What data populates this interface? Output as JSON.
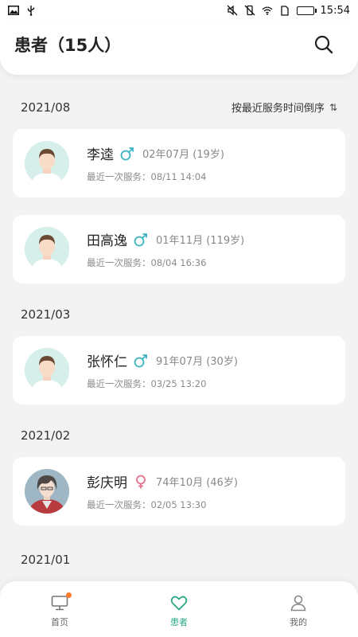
{
  "status_bar": {
    "time": "15:54",
    "battery_color": "#22c55e"
  },
  "header": {
    "title": "患者（15人）"
  },
  "sort": {
    "label": "按最近服务时间倒序",
    "icon": "sort-arrows-icon"
  },
  "groups": [
    {
      "date": "2021/08",
      "patients": [
        {
          "name": "李逵",
          "gender": "male",
          "age": "02年07月 (19岁)",
          "last": "最近一次服务：08/11 14:04"
        },
        {
          "name": "田高逸",
          "gender": "male",
          "age": "01年11月 (119岁)",
          "last": "最近一次服务：08/04 16:36"
        }
      ]
    },
    {
      "date": "2021/03",
      "patients": [
        {
          "name": "张怀仁",
          "gender": "male",
          "age": "91年07月 (30岁)",
          "last": "最近一次服务：03/25 13:20"
        }
      ]
    },
    {
      "date": "2021/02",
      "patients": [
        {
          "name": "彭庆明",
          "gender": "female",
          "age": "74年10月 (46岁)",
          "last": "最近一次服务：02/05 13:30"
        }
      ]
    },
    {
      "date": "2021/01",
      "patients": []
    }
  ],
  "tabs": [
    {
      "label": "首页",
      "icon": "monitor-icon",
      "active": false,
      "badge": true
    },
    {
      "label": "患者",
      "icon": "heart-icon",
      "active": true,
      "badge": false
    },
    {
      "label": "我的",
      "icon": "person-icon",
      "active": false,
      "badge": false
    }
  ],
  "colors": {
    "accent": "#2aa785",
    "male": "#3bb3c3",
    "female": "#e8718d",
    "badge": "#ff7a29"
  }
}
